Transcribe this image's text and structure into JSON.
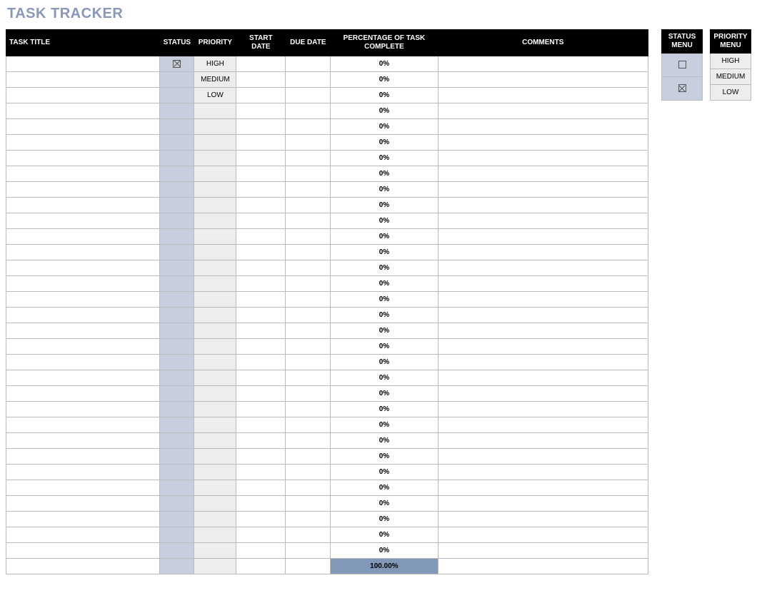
{
  "title": "TASK TRACKER",
  "columns": {
    "task_title": "TASK TITLE",
    "status": "STATUS",
    "priority": "PRIORITY",
    "start_date": "START DATE",
    "due_date": "DUE DATE",
    "percent": "PERCENTAGE OF TASK COMPLETE",
    "comments": "COMMENTS"
  },
  "rows": [
    {
      "title": "",
      "status_checked": true,
      "priority": "HIGH",
      "start": "",
      "due": "",
      "percent": "0%",
      "comments": ""
    },
    {
      "title": "",
      "status_checked": false,
      "priority": "MEDIUM",
      "start": "",
      "due": "",
      "percent": "0%",
      "comments": ""
    },
    {
      "title": "",
      "status_checked": false,
      "priority": "LOW",
      "start": "",
      "due": "",
      "percent": "0%",
      "comments": ""
    },
    {
      "title": "",
      "status_checked": false,
      "priority": "",
      "start": "",
      "due": "",
      "percent": "0%",
      "comments": ""
    },
    {
      "title": "",
      "status_checked": false,
      "priority": "",
      "start": "",
      "due": "",
      "percent": "0%",
      "comments": ""
    },
    {
      "title": "",
      "status_checked": false,
      "priority": "",
      "start": "",
      "due": "",
      "percent": "0%",
      "comments": ""
    },
    {
      "title": "",
      "status_checked": false,
      "priority": "",
      "start": "",
      "due": "",
      "percent": "0%",
      "comments": ""
    },
    {
      "title": "",
      "status_checked": false,
      "priority": "",
      "start": "",
      "due": "",
      "percent": "0%",
      "comments": ""
    },
    {
      "title": "",
      "status_checked": false,
      "priority": "",
      "start": "",
      "due": "",
      "percent": "0%",
      "comments": ""
    },
    {
      "title": "",
      "status_checked": false,
      "priority": "",
      "start": "",
      "due": "",
      "percent": "0%",
      "comments": ""
    },
    {
      "title": "",
      "status_checked": false,
      "priority": "",
      "start": "",
      "due": "",
      "percent": "0%",
      "comments": ""
    },
    {
      "title": "",
      "status_checked": false,
      "priority": "",
      "start": "",
      "due": "",
      "percent": "0%",
      "comments": ""
    },
    {
      "title": "",
      "status_checked": false,
      "priority": "",
      "start": "",
      "due": "",
      "percent": "0%",
      "comments": ""
    },
    {
      "title": "",
      "status_checked": false,
      "priority": "",
      "start": "",
      "due": "",
      "percent": "0%",
      "comments": ""
    },
    {
      "title": "",
      "status_checked": false,
      "priority": "",
      "start": "",
      "due": "",
      "percent": "0%",
      "comments": ""
    },
    {
      "title": "",
      "status_checked": false,
      "priority": "",
      "start": "",
      "due": "",
      "percent": "0%",
      "comments": ""
    },
    {
      "title": "",
      "status_checked": false,
      "priority": "",
      "start": "",
      "due": "",
      "percent": "0%",
      "comments": ""
    },
    {
      "title": "",
      "status_checked": false,
      "priority": "",
      "start": "",
      "due": "",
      "percent": "0%",
      "comments": ""
    },
    {
      "title": "",
      "status_checked": false,
      "priority": "",
      "start": "",
      "due": "",
      "percent": "0%",
      "comments": ""
    },
    {
      "title": "",
      "status_checked": false,
      "priority": "",
      "start": "",
      "due": "",
      "percent": "0%",
      "comments": ""
    },
    {
      "title": "",
      "status_checked": false,
      "priority": "",
      "start": "",
      "due": "",
      "percent": "0%",
      "comments": ""
    },
    {
      "title": "",
      "status_checked": false,
      "priority": "",
      "start": "",
      "due": "",
      "percent": "0%",
      "comments": ""
    },
    {
      "title": "",
      "status_checked": false,
      "priority": "",
      "start": "",
      "due": "",
      "percent": "0%",
      "comments": ""
    },
    {
      "title": "",
      "status_checked": false,
      "priority": "",
      "start": "",
      "due": "",
      "percent": "0%",
      "comments": ""
    },
    {
      "title": "",
      "status_checked": false,
      "priority": "",
      "start": "",
      "due": "",
      "percent": "0%",
      "comments": ""
    },
    {
      "title": "",
      "status_checked": false,
      "priority": "",
      "start": "",
      "due": "",
      "percent": "0%",
      "comments": ""
    },
    {
      "title": "",
      "status_checked": false,
      "priority": "",
      "start": "",
      "due": "",
      "percent": "0%",
      "comments": ""
    },
    {
      "title": "",
      "status_checked": false,
      "priority": "",
      "start": "",
      "due": "",
      "percent": "0%",
      "comments": ""
    },
    {
      "title": "",
      "status_checked": false,
      "priority": "",
      "start": "",
      "due": "",
      "percent": "0%",
      "comments": ""
    },
    {
      "title": "",
      "status_checked": false,
      "priority": "",
      "start": "",
      "due": "",
      "percent": "0%",
      "comments": ""
    },
    {
      "title": "",
      "status_checked": false,
      "priority": "",
      "start": "",
      "due": "",
      "percent": "0%",
      "comments": ""
    },
    {
      "title": "",
      "status_checked": false,
      "priority": "",
      "start": "",
      "due": "",
      "percent": "0%",
      "comments": ""
    }
  ],
  "total_percent": "100.00%",
  "status_menu": {
    "header": "STATUS MENU",
    "items": [
      {
        "checked": false
      },
      {
        "checked": true
      }
    ]
  },
  "priority_menu": {
    "header": "PRIORITY MENU",
    "items": [
      "HIGH",
      "MEDIUM",
      "LOW"
    ]
  }
}
